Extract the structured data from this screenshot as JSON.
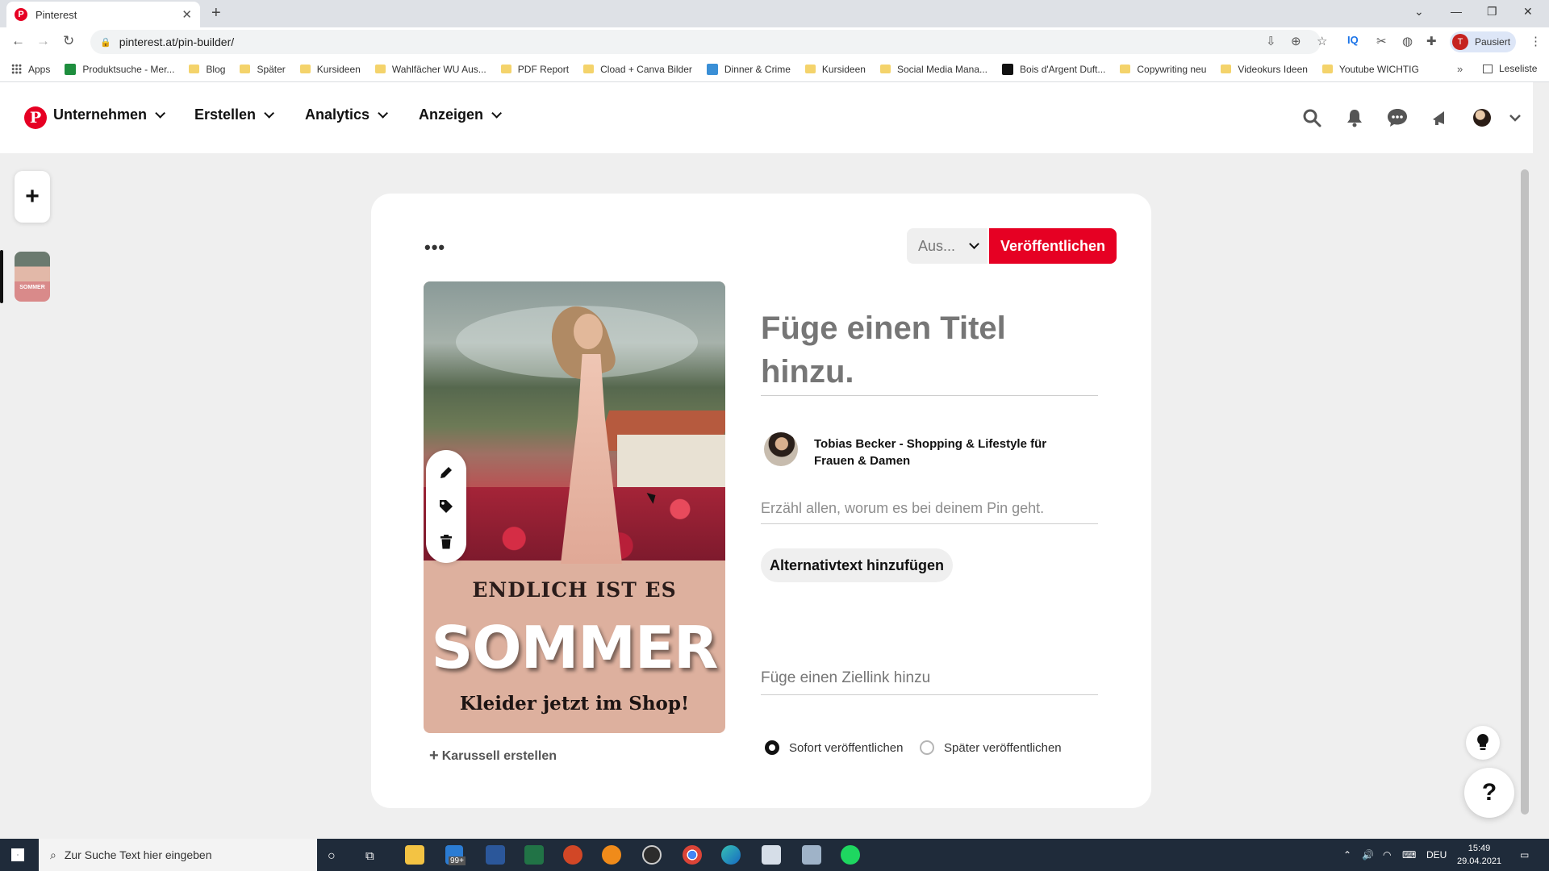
{
  "browser": {
    "tab_title": "Pinterest",
    "url": "pinterest.at/pin-builder/",
    "profile_initial": "T",
    "profile_status": "Pausiert",
    "bookmarks": [
      "Apps",
      "Produktsuche - Mer...",
      "Blog",
      "Später",
      "Kursideen",
      "Wahlfächer WU Aus...",
      "PDF Report",
      "Cload + Canva Bilder",
      "Dinner & Crime",
      "Kursideen",
      "Social Media Mana...",
      "Bois d'Argent Duft...",
      "Copywriting neu",
      "Videokurs Ideen",
      "Youtube WICHTIG"
    ],
    "reading_list": "Leseliste"
  },
  "header": {
    "nav": [
      "Unternehmen",
      "Erstellen",
      "Analytics",
      "Anzeigen"
    ]
  },
  "builder": {
    "board_select": "Aus...",
    "publish_label": "Veröffentlichen",
    "title_placeholder": "Füge einen Titel hinzu.",
    "owner_name": "Tobias Becker - Shopping & Lifestyle für Frauen & Damen",
    "description_placeholder": "Erzähl allen, worum es bei deinem Pin geht.",
    "alt_text_label": "Alternativtext hinzufügen",
    "link_placeholder": "Füge einen Ziellink hinzu",
    "carousel_label": "Karussell erstellen",
    "publish_now": "Sofort veröffentlichen",
    "publish_later": "Später veröffentlichen",
    "thumb_text": "SOMMER"
  },
  "pin_image": {
    "line1": "ENDLICH IST ES",
    "line2": "SOMMER",
    "line3": "Kleider jetzt im Shop!"
  },
  "taskbar": {
    "search_placeholder": "Zur Suche Text hier eingeben",
    "mail_badge": "99+",
    "language": "DEU",
    "time": "15:49",
    "date": "29.04.2021"
  },
  "colors": {
    "pinterest_red": "#e60023",
    "taskbar": "#1f2b3a"
  }
}
